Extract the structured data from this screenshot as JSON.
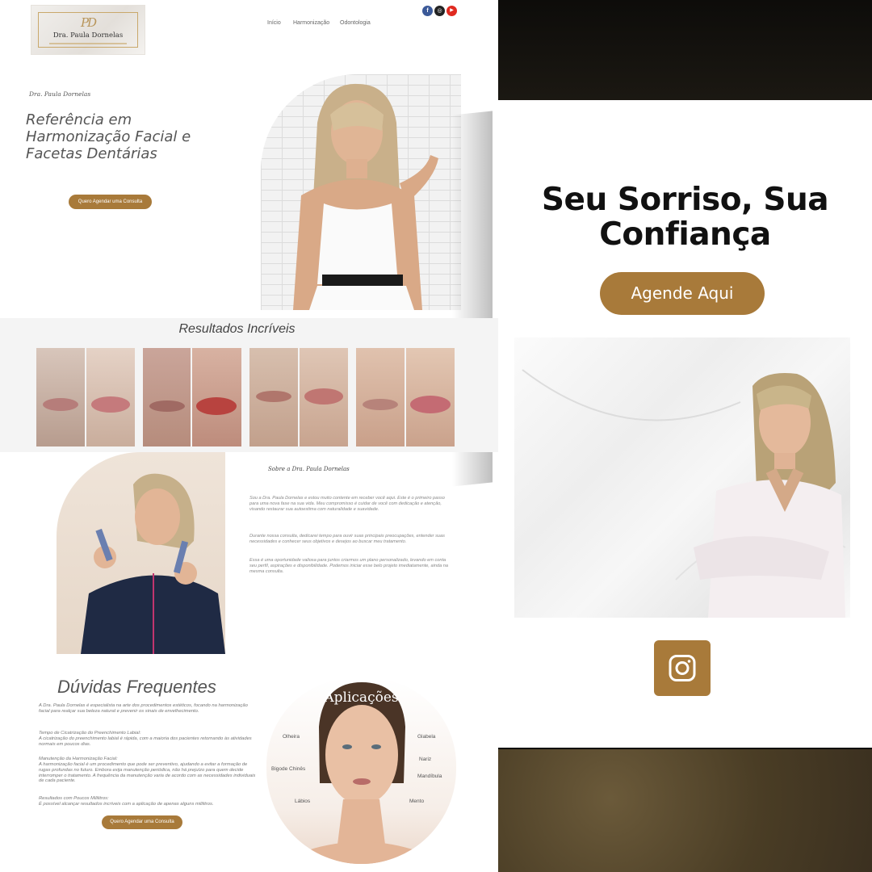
{
  "site": {
    "logo": {
      "monogram": "PD",
      "name": "Dra. Paula Dornelas"
    },
    "nav": [
      "Início",
      "Harmonização",
      "Odontologia"
    ],
    "social": [
      {
        "name": "facebook-icon",
        "glyph": "f",
        "color": "#3b5998"
      },
      {
        "name": "instagram-icon",
        "glyph": "◎",
        "color": "#222222"
      },
      {
        "name": "youtube-icon",
        "glyph": "▶",
        "color": "#e02a20"
      }
    ],
    "hero": {
      "kicker": "Dra. Paula Dornelas",
      "title": "Referência em Harmonização Facial e Facetas Dentárias",
      "cta": "Quero Agendar uma Consulta"
    },
    "results": {
      "title": "Resultados Incríveis"
    },
    "about": {
      "title": "Sobre a Dra. Paula Dornelas",
      "p1": "Sou a Dra. Paula Dornelas e estou muito contente em receber você aqui. Este é o primeiro passo para uma nova fase na sua vida. Meu compromisso é cuidar de você com dedicação e atenção, visando restaurar sua autoestima com naturalidade e suavidade.",
      "p2": "Durante nossa consulta, dedicarei tempo para ouvir suas principais preocupações, entender suas necessidades e conhecer seus objetivos e desejos ao buscar meu tratamento.",
      "p3": "Essa é uma oportunidade valiosa para juntos criarmos um plano personalizado, levando em conta seu perfil, aspirações e disponibilidade. Podemos iniciar esse belo projeto imediatamente, ainda na mesma consulta."
    },
    "faq": {
      "title": "Dúvidas Frequentes",
      "intro": "A Dra. Paula Dornelas é especialista na arte dos procedimentos estéticos, focando na harmonização facial para realçar sua beleza natural e prevenir os sinais de envelhecimento.",
      "q1": "Tempo de Cicatrização do Preenchimento Labial:",
      "a1": "A cicatrização do preenchimento labial é rápida, com a maioria dos pacientes retornando às atividades normais em poucos dias.",
      "q2": "Manutenção da Harmonização Facial:",
      "a2": "A harmonização facial é um procedimento que pode ser preventivo, ajudando a evitar a formação de rugas profundas no futuro. Embora exija manutenção periódica, não há prejuízo para quem decide interromper o tratamento. A frequência da manutenção varia de acordo com as necessidades individuais de cada paciente.",
      "q3": "Resultados com Poucos Mililitros:",
      "a3": "É possível alcançar resultados incríveis com a aplicação de apenas alguns mililitros.",
      "cta": "Quero Agendar uma Consulta"
    },
    "applications": {
      "title": "Aplicações",
      "labels": [
        "Olheira",
        "Glabela",
        "Nariz",
        "Bigode Chinês",
        "Mandíbula",
        "Lábios",
        "Mento"
      ]
    }
  },
  "story": {
    "title_line1": "Seu Sorriso, Sua",
    "title_line2": "Confiança",
    "cta": "Agende Aqui",
    "accent": "#a87a3a"
  }
}
